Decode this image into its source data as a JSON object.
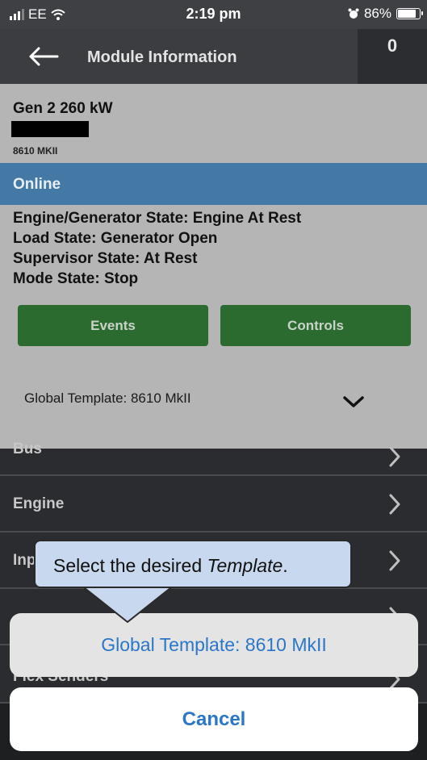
{
  "status_bar": {
    "carrier": "EE",
    "time": "2:19 pm",
    "battery": "86%",
    "battery_level": 0.86
  },
  "header": {
    "title": "Module Information",
    "counter": "0"
  },
  "module": {
    "name": "Gen 2 260 kW",
    "model": "8610 MKII",
    "connection_status": "Online",
    "states": [
      "Engine/Generator State: Engine At Rest",
      "Load State: Generator Open",
      "Supervisor State: At Rest",
      "Mode State: Stop"
    ]
  },
  "buttons": {
    "events": "Events",
    "controls": "Controls"
  },
  "template_selector": {
    "label": "Global Template: 8610 MkII"
  },
  "list": {
    "items": [
      {
        "label": "Bus"
      },
      {
        "label": "Engine"
      },
      {
        "label": "Inp"
      },
      {
        "label": ""
      },
      {
        "label": "Flex Senders"
      }
    ]
  },
  "tooltip": {
    "text_prefix": "Select the desired ",
    "text_emphasis": "Template",
    "text_suffix": "."
  },
  "action_sheet": {
    "option": "Global Template: 8610 MkII",
    "cancel": "Cancel"
  },
  "colors": {
    "accent_blue": "#2a76c9",
    "online_bar": "#4379a4",
    "button_green": "#2b6b2f",
    "tooltip_bg": "#c8d8ee"
  }
}
